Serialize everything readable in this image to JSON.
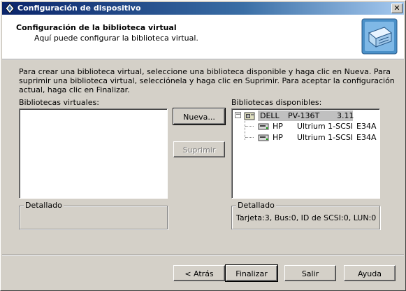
{
  "window": {
    "title": "Configuración de dispositivo",
    "close_glyph": "✕"
  },
  "header": {
    "title": "Configuración de la biblioteca virtual",
    "subtitle": "Aquí puede configurar la biblioteca virtual."
  },
  "intro_text": "Para crear una biblioteca virtual, seleccione una biblioteca disponible y haga clic en Nueva. Para suprimir una biblioteca virtual, selecciónela y haga clic en Suprimir. Para aceptar la configuración actual, haga clic en Finalizar.",
  "left": {
    "label": "Bibliotecas virtuales:",
    "items": [],
    "details_label": "Detallado",
    "details_text": ""
  },
  "buttons": {
    "new": "Nueva...",
    "delete": "Suprimir",
    "back": "< Atrás",
    "finish": "Finalizar",
    "exit": "Salir",
    "help": "Ayuda"
  },
  "right": {
    "label": "Bibliotecas disponibles:",
    "tree": {
      "expander": "−",
      "root": {
        "vendor": "DELL",
        "model": "PV-136T",
        "rev": "3.11",
        "icon": "tape-library-icon"
      },
      "children": [
        {
          "vendor": "HP",
          "model": "Ultrium 1-SCSI",
          "rev": "E34A",
          "icon": "tape-drive-icon"
        },
        {
          "vendor": "HP",
          "model": "Ultrium 1-SCSI",
          "rev": "E34A",
          "icon": "tape-drive-icon"
        }
      ]
    },
    "details_label": "Detallado",
    "details_text": "Tarjeta:3, Bus:0, ID de SCSI:0, LUN:0"
  },
  "colors": {
    "titlebar_start": "#0a246a",
    "titlebar_end": "#a6caf0",
    "face": "#d4d0c8",
    "selection": "#c0c0c0"
  }
}
